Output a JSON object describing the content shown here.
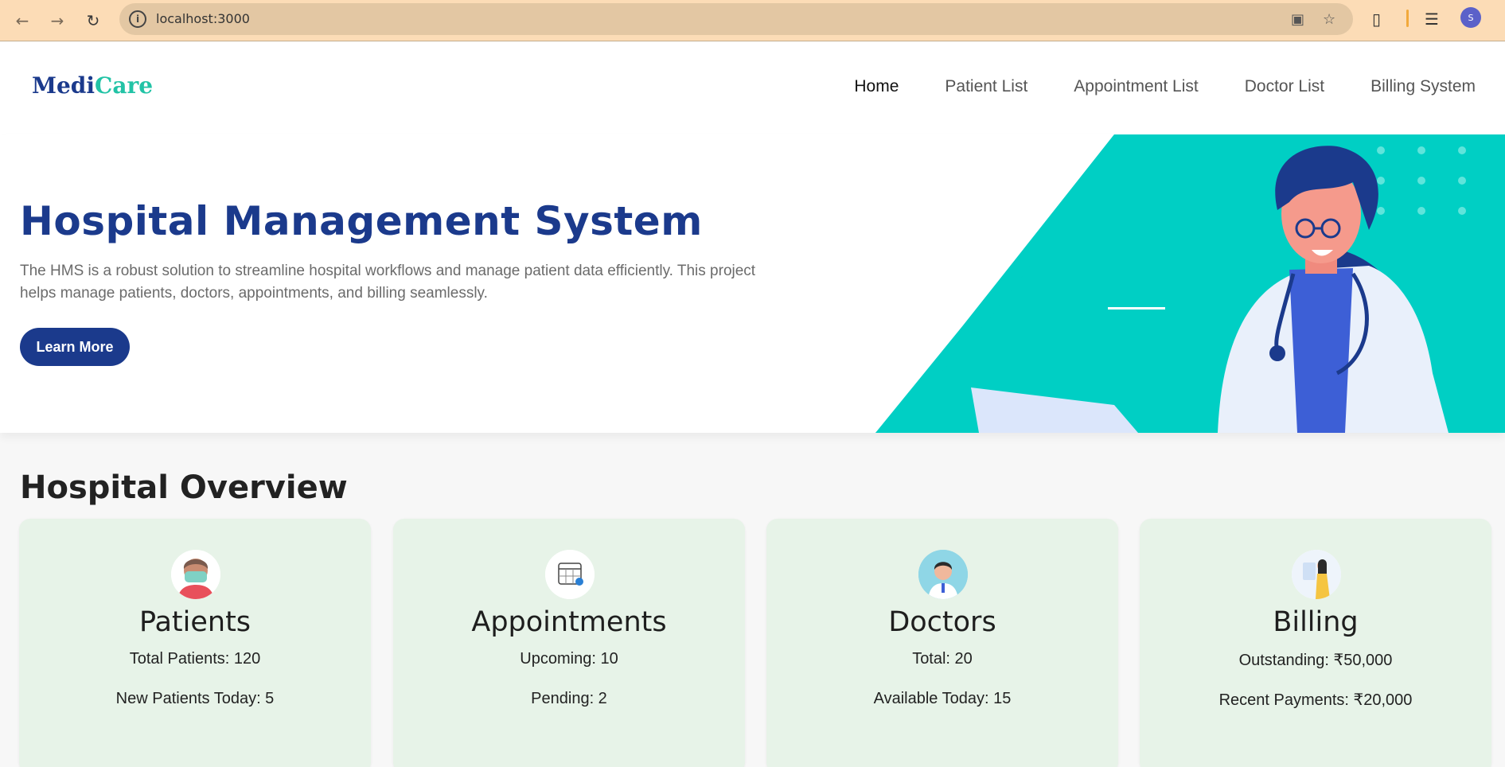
{
  "browser": {
    "url": "localhost:3000",
    "profile_initial": "S"
  },
  "brand": {
    "part1": "Medi",
    "part2": "Care",
    "color1": "#1b3a8c",
    "color2": "#22c3a6"
  },
  "nav": {
    "items": [
      {
        "label": "Home",
        "active": true
      },
      {
        "label": "Patient List"
      },
      {
        "label": "Appointment List"
      },
      {
        "label": "Doctor List"
      },
      {
        "label": "Billing System"
      }
    ]
  },
  "hero": {
    "title": "Hospital Management System",
    "description": "The HMS is a robust solution to streamline hospital workflows and manage patient data efficiently. This project helps manage patients, doctors, appointments, and billing seamlessly.",
    "button_label": "Learn More",
    "accent_color": "#00cfc4"
  },
  "overview": {
    "title": "Hospital Overview",
    "cards": [
      {
        "title": "Patients",
        "line1": "Total Patients: 120",
        "line2": "New Patients Today: 5",
        "icon": "masked-patient-icon"
      },
      {
        "title": "Appointments",
        "line1": "Upcoming: 10",
        "line2": "Pending: 2",
        "icon": "calendar-icon"
      },
      {
        "title": "Doctors",
        "line1": "Total: 20",
        "line2": "Available Today: 15",
        "icon": "doctor-icon"
      },
      {
        "title": "Billing",
        "line1": "Outstanding: ₹50,000",
        "line2": "Recent Payments: ₹20,000",
        "icon": "billing-person-icon"
      }
    ]
  }
}
